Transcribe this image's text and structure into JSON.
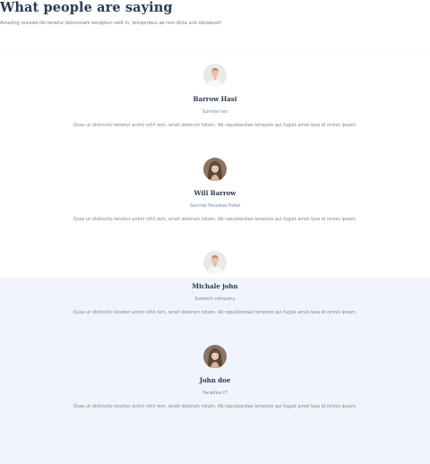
{
  "header": {
    "title": "What people are saying",
    "subtitle": "Amazing reviews illo tenetur laboriosam excepturi velit in, temporibus ab rem dicta sint obcaecati!"
  },
  "testimonials": [
    {
      "name": "Barrow Hasi",
      "company": "Sunrise ten",
      "quote": "Quas ut distinctio tenetur animi nihil rem, amet dolorum totam. Ab repudiandae tempore qui fugiat amet ipsa id omnis ipsam.",
      "avatar": "man-portrait"
    },
    {
      "name": "Will Barrow",
      "company": "Sunrise Paradise Hotel",
      "quote": "Quas ut distinctio tenetur animi nihil rem, amet dolorum totam. Ab repudiandae tempore qui fugiat amet ipsa id omnis ipsam.",
      "avatar": "woman-portrait"
    },
    {
      "name": "Michale john",
      "company": "Suntech company",
      "quote": "Quas ut distinctio tenetur animi nihil rem, amet dolorum totam. Ab repudiandae tempore qui fugiat amet ipsa id omnis ipsam.",
      "avatar": "man-portrait"
    },
    {
      "name": "John doe",
      "company": "Paradise IT",
      "quote": "Quas ut distinctio tenetur animi nihil rem, amet dolorum totam. Ab repudiandae tempore qui fugiat amet ipsa id omnis ipsam.",
      "avatar": "woman-portrait"
    }
  ],
  "colors": {
    "heading": "#2a3a55",
    "body_text": "#7a8699",
    "lower_band": "#f1f4fa"
  }
}
